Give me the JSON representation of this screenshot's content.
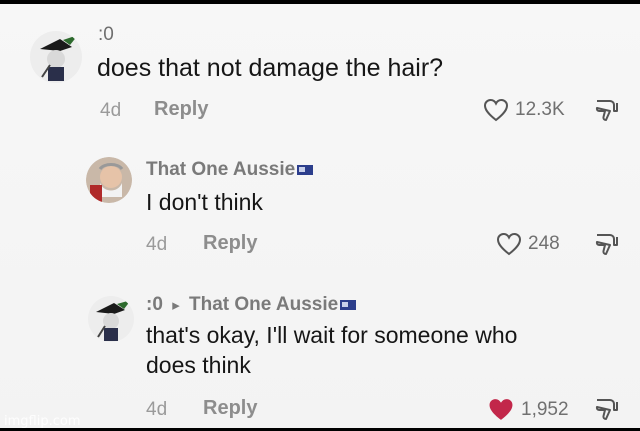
{
  "comments": [
    {
      "username": ":0",
      "text": "does that not damage the hair?",
      "age": "4d",
      "reply_label": "Reply",
      "likes": "12.3K",
      "liked": false
    },
    {
      "username": "That One Aussie",
      "text": "I don't think",
      "age": "4d",
      "reply_label": "Reply",
      "likes": "248",
      "liked": false
    },
    {
      "username": ":0",
      "arrow": "▸",
      "reply_to": "That One Aussie",
      "text_line1": "that's okay, I'll wait for someone who",
      "text_line2": "does think",
      "age": "4d",
      "reply_label": "Reply",
      "likes": "1,952",
      "liked": true
    }
  ],
  "colors": {
    "liked_heart": "#c2274a",
    "text": "#161616",
    "meta": "#8d8d8d"
  },
  "watermark": "imgflip.com"
}
